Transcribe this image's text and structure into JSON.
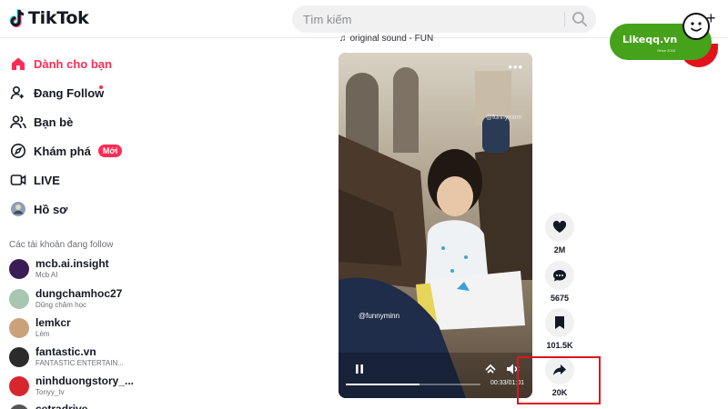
{
  "header": {
    "logo_text": "TikTok",
    "search_placeholder": "Tìm kiếm",
    "upload_symbol": "+"
  },
  "sidebar": {
    "items": [
      {
        "label": "Dành cho bạn",
        "icon": "home-icon",
        "active": true
      },
      {
        "label": "Đang Follow",
        "icon": "following-icon",
        "has_dot": true
      },
      {
        "label": "Bạn bè",
        "icon": "friends-icon"
      },
      {
        "label": "Khám phá",
        "icon": "compass-icon",
        "badge": "Mới"
      },
      {
        "label": "LIVE",
        "icon": "live-icon"
      },
      {
        "label": "Hồ sơ",
        "icon": "profile-avatar-icon"
      }
    ],
    "following_title": "Các tài khoản đang follow",
    "accounts": [
      {
        "name": "mcb.ai.insight",
        "sub": "Mcb AI",
        "color": "#3a1d57"
      },
      {
        "name": "dungchamhoc27",
        "sub": "Dũng chăm học",
        "color": "#a7c7b0"
      },
      {
        "name": "lemkcr",
        "sub": "Lèm",
        "color": "#c9a27c"
      },
      {
        "name": "fantastic.vn",
        "sub": "FANTASTIC ENTERTAIN...",
        "color": "#2b2b2b"
      },
      {
        "name": "ninhduongstory_...",
        "sub": "Tonyy_tv",
        "color": "#d8262e"
      },
      {
        "name": "cetradrive",
        "sub": "",
        "color": "#555555"
      }
    ]
  },
  "video": {
    "sound": "original sound - FUN",
    "watermark": "@funnyminn",
    "watermark_top": "@funnyminn",
    "time": "00:33/01:01",
    "progress": 0.55
  },
  "actions": [
    {
      "icon": "heart-icon",
      "count": "2M"
    },
    {
      "icon": "comment-icon",
      "count": "5675"
    },
    {
      "icon": "bookmark-icon",
      "count": "101.5K"
    },
    {
      "icon": "share-icon",
      "count": "20K"
    }
  ],
  "brand_watermark": {
    "text": "Likeqq.vn",
    "tagline": "Since 2016"
  },
  "colors": {
    "accent": "#fe2c55",
    "highlight_box": "#e0141e"
  }
}
